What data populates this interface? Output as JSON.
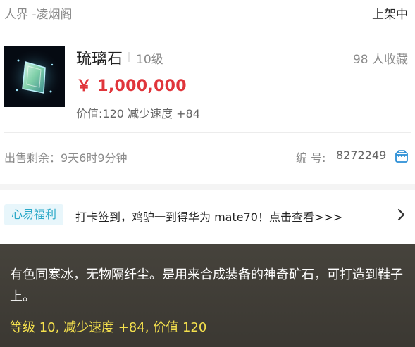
{
  "header": {
    "location": "人界 -凌烟阁",
    "status": "上架中"
  },
  "item": {
    "icon": "jade-crystal-icon",
    "name": "琉璃石",
    "level": "10级",
    "favorites": "98 人收藏",
    "price": "￥ 1,000,000",
    "stats": "价值:120 减少速度 +84"
  },
  "sale": {
    "remaining": "出售剩余：9天6时9分钟",
    "id_label": "编 号:",
    "id_value": "8272249"
  },
  "promo": {
    "badge": "心易福利",
    "text": "打卡签到，鸡驴一到得华为 mate70！点击查看>>>"
  },
  "tooltip": {
    "description": "有色同寒冰，无物隔纤尘。是用来合成装备的神奇矿石，可打造到鞋子上。",
    "stats": "等级 10, 减少速度 +84, 价值 120"
  },
  "colors": {
    "price": "#e0353b",
    "badge_text": "#2aa8c7",
    "badge_bg": "#e8f6fb",
    "tooltip_bg": "#413e37",
    "tooltip_stats": "#f4e04d"
  }
}
